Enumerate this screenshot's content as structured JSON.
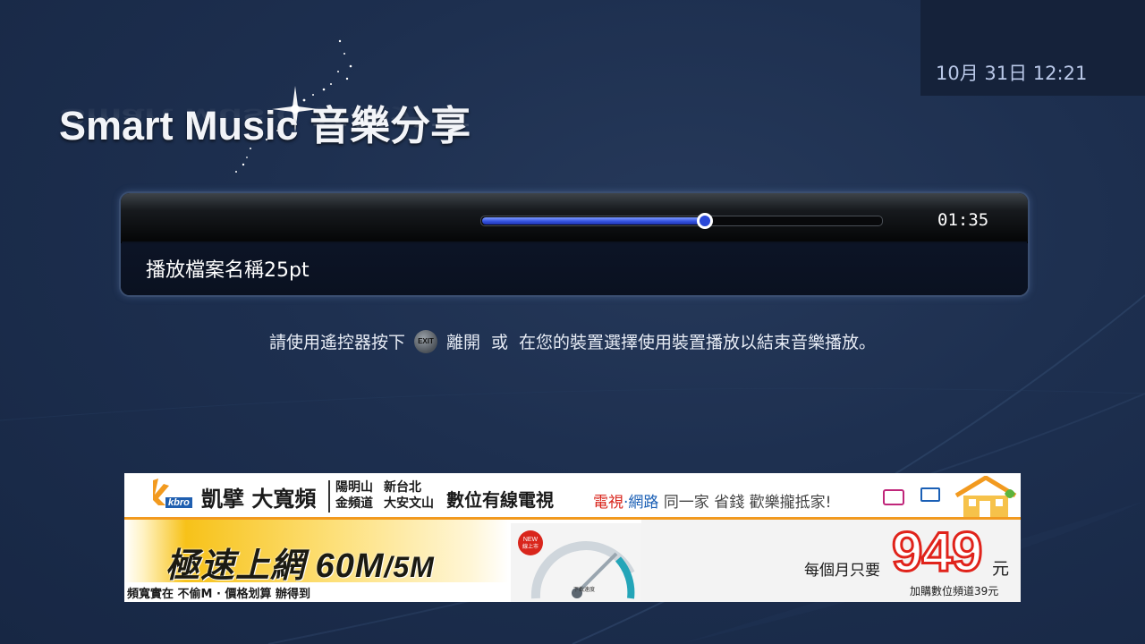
{
  "header": {
    "title": "Smart Music 音樂分享",
    "clock": "10月 31日 12:21"
  },
  "player": {
    "time": "01:35",
    "progress": 0.56,
    "filename": "播放檔案名稱25pt"
  },
  "instruction": {
    "before": "請使用遙控器按下",
    "button": "EXIT",
    "middle": "離開",
    "or": "或",
    "after": "在您的裝置選擇使用裝置播放以結束音樂播放。"
  },
  "banner": {
    "logo_text": "kbro",
    "brand": "凱擘 大寬頻",
    "areas": [
      "陽明山",
      "新台北",
      "金頻道",
      "大安文山"
    ],
    "digital": "數位有線電視",
    "slogan_tv": "電視",
    "slogan_dot": "·",
    "slogan_net": "網路",
    "slogan_family": "同一家",
    "slogan_save": "省錢 歡樂攏抵家!",
    "speed_main": "極速上網 60M",
    "speed_small": "/5M",
    "tagline": "頻寬實在 不偷M · 價格划算 辦得到",
    "new_badge": "NEW 線上市",
    "gauge_label": "下載速度",
    "per_month": "每個月只要",
    "price": "949",
    "yuan": "元",
    "addon": "加購數位頻道39元"
  },
  "colors": {
    "background": "#1d2f4f",
    "progress": "#3553e0",
    "price": "#e0231b"
  }
}
